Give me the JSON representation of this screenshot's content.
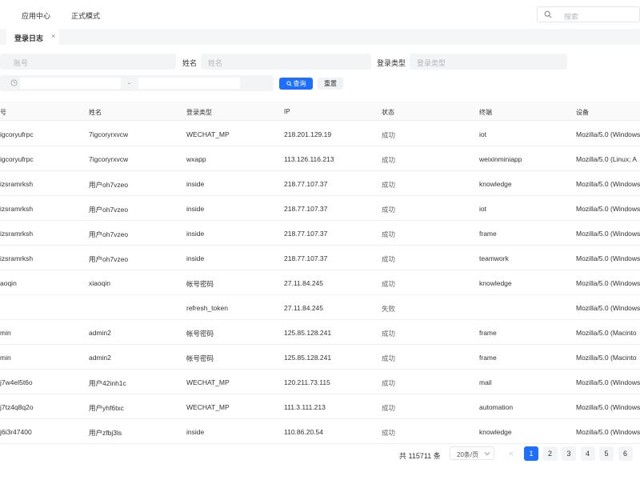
{
  "topbar": {
    "menu": [
      "应用中心",
      "正式模式"
    ],
    "search_placeholder": "搜索"
  },
  "tabs": [
    {
      "label": "登录日志",
      "close": "×"
    }
  ],
  "filters": {
    "account_placeholder": "账号",
    "name_label": "姓名",
    "name_placeholder": "姓名",
    "login_type_label": "登录类型",
    "login_type_placeholder": "登录类型",
    "date_separator": "-",
    "query_button": "查询",
    "reset_button": "重置"
  },
  "table": {
    "headers": [
      "号",
      "姓名",
      "登录类型",
      "IP",
      "状态",
      "终端",
      "设备"
    ],
    "rows": [
      [
        "igcoryufrpc",
        "7igcoryrxvcw",
        "WECHAT_MP",
        "218.201.129.19",
        "成功",
        "iot",
        "Mozilla/5.0 (Windows"
      ],
      [
        "igcoryufrpc",
        "7igcoryrxvcw",
        "wxapp",
        "113.126.116.213",
        "成功",
        "weixinminiapp",
        "Mozilla/5.0 (Linux; A"
      ],
      [
        "izsramrksh",
        "用户oh7vzeo",
        "inside",
        "218.77.107.37",
        "成功",
        "knowledge",
        "Mozilla/5.0 (Windows"
      ],
      [
        "izsramrksh",
        "用户oh7vzeo",
        "inside",
        "218.77.107.37",
        "成功",
        "iot",
        "Mozilla/5.0 (Windows"
      ],
      [
        "izsramrksh",
        "用户oh7vzeo",
        "inside",
        "218.77.107.37",
        "成功",
        "frame",
        "Mozilla/5.0 (Windows"
      ],
      [
        "izsramrksh",
        "用户oh7vzeo",
        "inside",
        "218.77.107.37",
        "成功",
        "teamwork",
        "Mozilla/5.0 (Windows"
      ],
      [
        "aoqin",
        "xiaoqin",
        "帐号密码",
        "27.11.84.245",
        "成功",
        "knowledge",
        "Mozilla/5.0 (Windows"
      ],
      [
        "",
        "",
        "refresh_token",
        "27.11.84.245",
        "失败",
        "",
        "Mozilla/5.0 (Windows"
      ],
      [
        "min",
        "admin2",
        "帐号密码",
        "125.85.128.241",
        "成功",
        "frame",
        "Mozilla/5.0 (Macinto"
      ],
      [
        "min",
        "admin2",
        "帐号密码",
        "125.85.128.241",
        "成功",
        "frame",
        "Mozilla/5.0 (Macinto"
      ],
      [
        "j7w4el5t6o",
        "用户42inh1c",
        "WECHAT_MP",
        "120.211.73.115",
        "成功",
        "mail",
        "Mozilla/5.0 (Windows"
      ],
      [
        "j7tz4q8q2o",
        "用户yhf6txc",
        "WECHAT_MP",
        "111.3.111.213",
        "成功",
        "automation",
        "Mozilla/5.0 (Windows"
      ],
      [
        "j6i3r47400",
        "用户zfbj3ls",
        "inside",
        "110.86.20.54",
        "成功",
        "knowledge",
        "Mozilla/5.0 (Windows"
      ]
    ]
  },
  "pagination": {
    "total": "共 115711 条",
    "page_size": "20条/页",
    "prev": "<",
    "pages": [
      "1",
      "2",
      "3",
      "4",
      "5",
      "6"
    ],
    "current": "1"
  },
  "colors": {
    "primary": "#1e6fff",
    "status_success": "#666666"
  }
}
